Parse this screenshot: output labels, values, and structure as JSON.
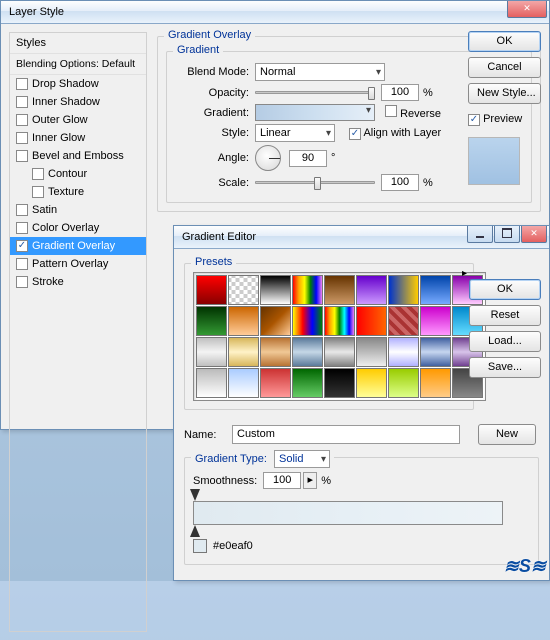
{
  "layer_style": {
    "title": "Layer Style",
    "styles_header": "Styles",
    "blending_label": "Blending Options: Default",
    "items": [
      {
        "label": "Drop Shadow",
        "checked": false
      },
      {
        "label": "Inner Shadow",
        "checked": false
      },
      {
        "label": "Outer Glow",
        "checked": false
      },
      {
        "label": "Inner Glow",
        "checked": false
      },
      {
        "label": "Bevel and Emboss",
        "checked": false
      },
      {
        "label": "Contour",
        "checked": false,
        "sub": true
      },
      {
        "label": "Texture",
        "checked": false,
        "sub": true
      },
      {
        "label": "Satin",
        "checked": false
      },
      {
        "label": "Color Overlay",
        "checked": false
      },
      {
        "label": "Gradient Overlay",
        "checked": true,
        "selected": true
      },
      {
        "label": "Pattern Overlay",
        "checked": false
      },
      {
        "label": "Stroke",
        "checked": false
      }
    ],
    "group_title": "Gradient Overlay",
    "sub_group": "Gradient",
    "blend_mode_label": "Blend Mode:",
    "blend_mode_value": "Normal",
    "opacity_label": "Opacity:",
    "opacity_value": "100",
    "pct": "%",
    "gradient_label": "Gradient:",
    "reverse_label": "Reverse",
    "style_label": "Style:",
    "style_value": "Linear",
    "align_label": "Align with Layer",
    "angle_label": "Angle:",
    "angle_value": "90",
    "degree": "°",
    "scale_label": "Scale:",
    "scale_value": "100",
    "buttons": {
      "ok": "OK",
      "cancel": "Cancel",
      "newstyle": "New Style...",
      "preview": "Preview"
    }
  },
  "gradient_editor": {
    "title": "Gradient Editor",
    "presets_label": "Presets",
    "name_label": "Name:",
    "name_value": "Custom",
    "type_label": "Gradient Type:",
    "type_value": "Solid",
    "smoothness_label": "Smoothness:",
    "smoothness_value": "100",
    "pct": "%",
    "color_hex": "#e0eaf0",
    "buttons": {
      "ok": "OK",
      "reset": "Reset",
      "load": "Load...",
      "save": "Save...",
      "new": "New"
    },
    "swatches": [
      "linear-gradient(#ff0000,#880000)",
      "repeating-conic-gradient(#ccc 0 25%,#fff 0 50%) 50%/8px 8px",
      "linear-gradient(#000,#fff)",
      "linear-gradient(90deg,red,orange,yellow,green,blue,violet)",
      "linear-gradient(#663300,#cc9966)",
      "linear-gradient(#6600cc,#cc99ff)",
      "linear-gradient(90deg,#0033cc,#ffcc00)",
      "linear-gradient(#0044aa,#77aaff)",
      "linear-gradient(#8800aa,#ffccff)",
      "linear-gradient(#003300,#339933)",
      "linear-gradient(#cc6600,#ffcc99)",
      "linear-gradient(135deg,#663300,#aa5500,#ffcc99)",
      "linear-gradient(90deg,yellow,red,blue,green)",
      "linear-gradient(90deg,red,orange,yellow,green,cyan,blue,violet)",
      "linear-gradient(90deg,#ff0000,#ff6600)",
      "repeating-linear-gradient(45deg,#aa3333 0 4px,#cc6666 4px 8px)",
      "linear-gradient(#cc00cc,#ff99ff)",
      "linear-gradient(#0088cc,#66ddff)",
      "linear-gradient(#c0c0c0,#f4f4f4,#c0c0c0)",
      "linear-gradient(#d7b65a,#fff2c8,#d7b65a)",
      "linear-gradient(#b87333,#f0c896,#b87333)",
      "linear-gradient(#5a7a9a,#c5d7e7,#5a7a9a)",
      "linear-gradient(#808080,#e8e8e8,#808080)",
      "linear-gradient(#888888,#eeeeee)",
      "linear-gradient(#b0b0ff,#ffffff,#b0b0ff)",
      "linear-gradient(#4060a0,#c6d6f0,#4060a0)",
      "linear-gradient(#704090,#d8c4ea,#704090)",
      "linear-gradient(#bbbbbb,#ffffff)",
      "linear-gradient(180deg,#aaccff,#ffffff)",
      "linear-gradient(#cc3333,#ff9999)",
      "linear-gradient(#006600,#66cc66)",
      "linear-gradient(#000000,#333333)",
      "linear-gradient(#ffcc00,#ffff99)",
      "linear-gradient(#99cc00,#ddff88)",
      "linear-gradient(#ff9900,#ffcc88)",
      "linear-gradient(#444,#888)"
    ]
  }
}
